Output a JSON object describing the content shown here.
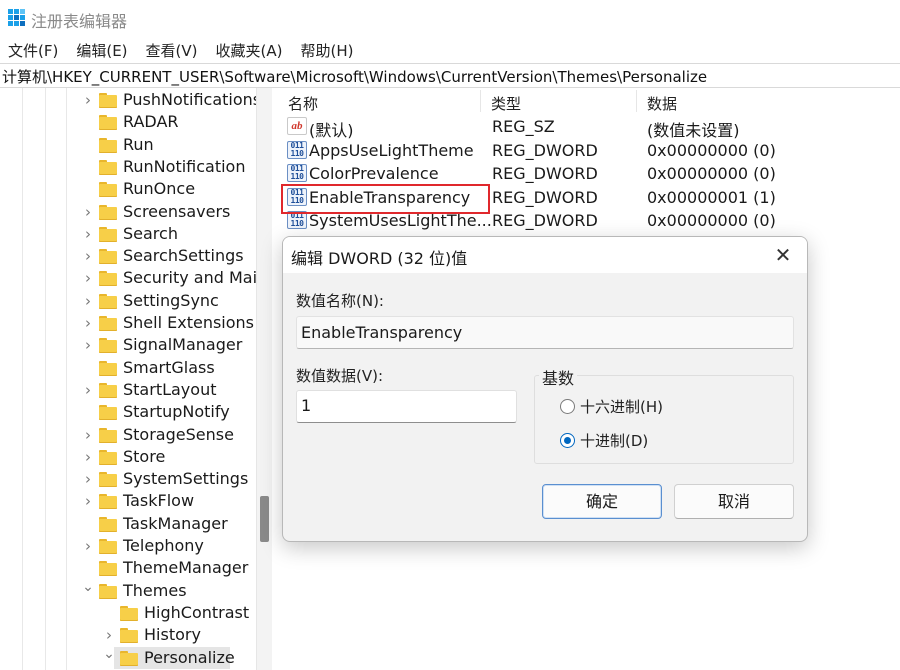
{
  "window": {
    "title": "注册表编辑器"
  },
  "menu": [
    "文件(F)",
    "编辑(E)",
    "查看(V)",
    "收藏夹(A)",
    "帮助(H)"
  ],
  "address": "计算机\\HKEY_CURRENT_USER\\Software\\Microsoft\\Windows\\CurrentVersion\\Themes\\Personalize",
  "tree": {
    "items": [
      {
        "label": "PushNotifications",
        "expandable": true,
        "level": 1
      },
      {
        "label": "RADAR",
        "expandable": false,
        "level": 1
      },
      {
        "label": "Run",
        "expandable": false,
        "level": 1
      },
      {
        "label": "RunNotification",
        "expandable": false,
        "level": 1
      },
      {
        "label": "RunOnce",
        "expandable": false,
        "level": 1
      },
      {
        "label": "Screensavers",
        "expandable": true,
        "level": 1
      },
      {
        "label": "Search",
        "expandable": true,
        "level": 1
      },
      {
        "label": "SearchSettings",
        "expandable": true,
        "level": 1
      },
      {
        "label": "Security and Main",
        "expandable": true,
        "level": 1
      },
      {
        "label": "SettingSync",
        "expandable": true,
        "level": 1
      },
      {
        "label": "Shell Extensions",
        "expandable": true,
        "level": 1
      },
      {
        "label": "SignalManager",
        "expandable": true,
        "level": 1
      },
      {
        "label": "SmartGlass",
        "expandable": false,
        "level": 1
      },
      {
        "label": "StartLayout",
        "expandable": true,
        "level": 1
      },
      {
        "label": "StartupNotify",
        "expandable": false,
        "level": 1
      },
      {
        "label": "StorageSense",
        "expandable": true,
        "level": 1
      },
      {
        "label": "Store",
        "expandable": true,
        "level": 1
      },
      {
        "label": "SystemSettings",
        "expandable": true,
        "level": 1
      },
      {
        "label": "TaskFlow",
        "expandable": true,
        "level": 1
      },
      {
        "label": "TaskManager",
        "expandable": false,
        "level": 1
      },
      {
        "label": "Telephony",
        "expandable": true,
        "level": 1
      },
      {
        "label": "ThemeManager",
        "expandable": false,
        "level": 1
      },
      {
        "label": "Themes",
        "expandable": true,
        "expanded": true,
        "level": 1
      },
      {
        "label": "HighContrast",
        "expandable": false,
        "level": 2
      },
      {
        "label": "History",
        "expandable": true,
        "level": 2
      },
      {
        "label": "Personalize",
        "expandable": true,
        "expanded": true,
        "level": 2,
        "selected": true
      }
    ]
  },
  "list": {
    "headers": {
      "name": "名称",
      "type": "类型",
      "data": "数据"
    },
    "rows": [
      {
        "icon": "string-value-icon",
        "name": "(默认)",
        "type": "REG_SZ",
        "data": "(数值未设置)"
      },
      {
        "icon": "dword-value-icon",
        "name": "AppsUseLightTheme",
        "type": "REG_DWORD",
        "data": "0x00000000 (0)"
      },
      {
        "icon": "dword-value-icon",
        "name": "ColorPrevalence",
        "type": "REG_DWORD",
        "data": "0x00000000 (0)"
      },
      {
        "icon": "dword-value-icon",
        "name": "EnableTransparency",
        "type": "REG_DWORD",
        "data": "0x00000001 (1)",
        "highlighted": true
      },
      {
        "icon": "dword-value-icon",
        "name": "SystemUsesLightThe...",
        "type": "REG_DWORD",
        "data": "0x00000000 (0)"
      }
    ]
  },
  "dialog": {
    "title": "编辑 DWORD (32 位)值",
    "close_glyph": "✕",
    "name_label": "数值名称(N):",
    "name_value": "EnableTransparency",
    "data_label": "数值数据(V):",
    "data_value": "1",
    "base_label": "基数",
    "radio_hex": "十六进制(H)",
    "radio_dec": "十进制(D)",
    "selected_base": "decimal",
    "ok_label": "确定",
    "cancel_label": "取消"
  },
  "colors": {
    "highlight_border": "#e0282c",
    "folder": "#f7cf48",
    "accent": "#0067c0"
  }
}
